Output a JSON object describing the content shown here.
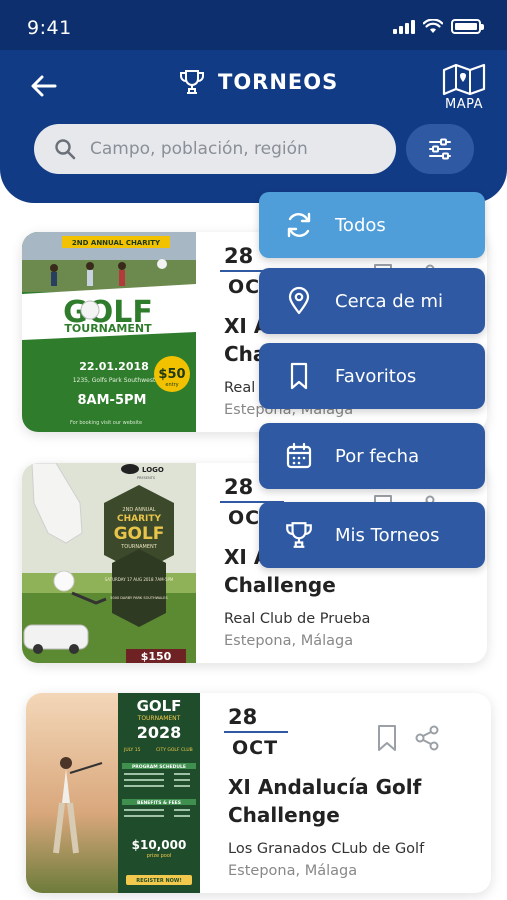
{
  "status": {
    "time": "9:41"
  },
  "header": {
    "title": "TORNEOS",
    "map_label": "MAPA"
  },
  "search": {
    "placeholder": "Campo, población, región",
    "value": ""
  },
  "menu": {
    "items": [
      {
        "label": "Todos",
        "icon": "refresh-icon",
        "active": true
      },
      {
        "label": "Cerca de mi",
        "icon": "location-pin-icon",
        "active": false
      },
      {
        "label": "Favoritos",
        "icon": "bookmark-icon",
        "active": false
      },
      {
        "label": "Por fecha",
        "icon": "calendar-icon",
        "active": false
      },
      {
        "label": "Mis Torneos",
        "icon": "trophy-icon",
        "active": false
      }
    ]
  },
  "tournaments": [
    {
      "day": "28",
      "month": "OCT",
      "title_line1": "XI Andalucía Golf",
      "title_line2": "Challenge",
      "club": "Real Club de Prueba",
      "location": "Estepona, Málaga",
      "poster": {
        "banner": "2ND ANNUAL CHARITY",
        "title": "GOLF",
        "subtitle": "TOURNAMENT",
        "date": "22.01.2018",
        "venue": "1235, Golfs Park Southwest",
        "hours": "8AM-5PM",
        "price": "$50",
        "price_note": "entry",
        "footer": "For booking visit our website"
      }
    },
    {
      "day": "28",
      "month": "OCT",
      "title_line1": "XI Andalucía Golf",
      "title_line2": "Challenge",
      "club": "Real Club de Prueba",
      "location": "Estepona, Málaga",
      "poster": {
        "logo": "LOGO",
        "logo_sub": "PRESENTS",
        "banner": "2ND ANNUAL",
        "title1": "CHARITY",
        "title2": "GOLF",
        "subtitle": "TOURNAMENT",
        "details": "SATURDAY 17 AUG 2018 7AM-5PM",
        "venue": "5000 DARBY PARK SOUTHWALES",
        "price": "$150"
      }
    },
    {
      "day": "28",
      "month": "OCT",
      "title_line1": "XI Andalucía Golf",
      "title_line2": "Challenge",
      "club": "Los Granados CLub de Golf",
      "location": "Estepona, Málaga",
      "poster": {
        "title": "GOLF",
        "subtitle": "TOURNAMENT",
        "year": "2028",
        "date": "JULY 15",
        "club": "CITY GOLF CLUB",
        "section1": "PROGRAM SCHEDULE",
        "section2": "BENEFITS & FEES",
        "prize": "$10,000",
        "prize_note": "prize pool",
        "register": "REGISTER NOW!"
      }
    }
  ],
  "colors": {
    "header": "#123b86",
    "statusbar": "#0e2f6e",
    "menu": "#2f5aa3",
    "menu_active": "#4f9ed9",
    "accent_line": "#2f5aa3"
  }
}
